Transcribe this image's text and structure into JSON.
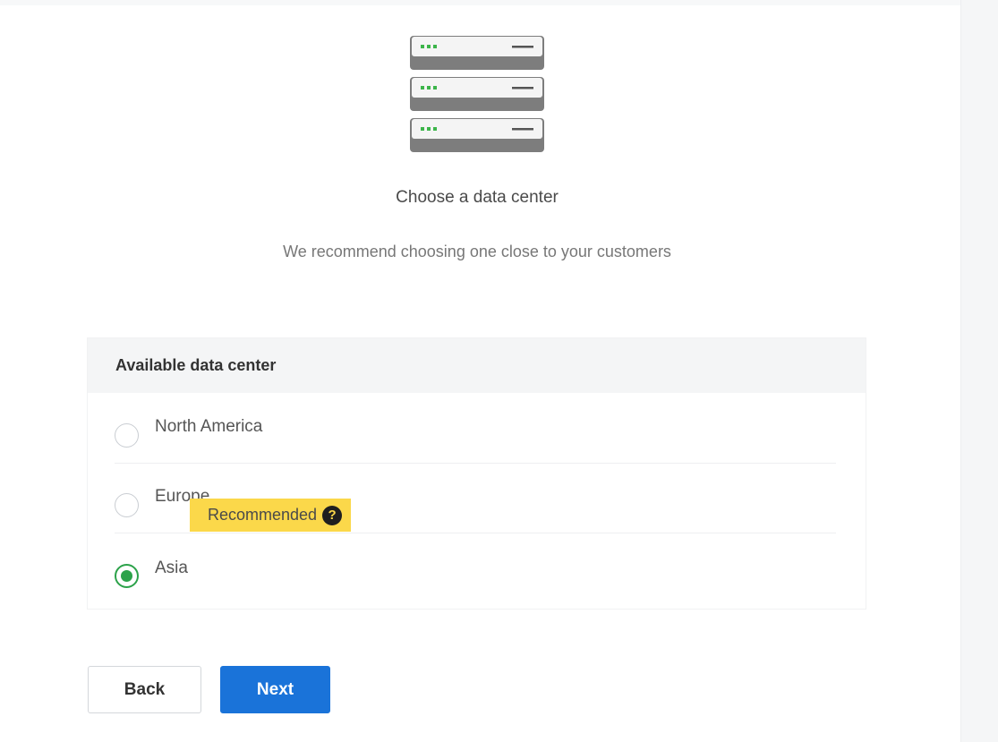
{
  "header": {
    "title": "Choose a data center",
    "subtitle": "We recommend choosing one close to your customers"
  },
  "icons": {
    "hero": "server-rack-icon",
    "help": "question-circle-icon"
  },
  "card": {
    "header": "Available data center",
    "options": [
      {
        "label": "North America",
        "selected": false
      },
      {
        "label": "Europe",
        "selected": false
      },
      {
        "label": "Asia",
        "selected": true
      }
    ],
    "badge": {
      "label": "Recommended",
      "help_glyph": "?"
    }
  },
  "actions": {
    "back_label": "Back",
    "next_label": "Next"
  },
  "colors": {
    "primary": "#1a73d9",
    "selected_radio": "#2ca24a",
    "badge": "#fbd84a",
    "status_led": "#3cb54a"
  }
}
